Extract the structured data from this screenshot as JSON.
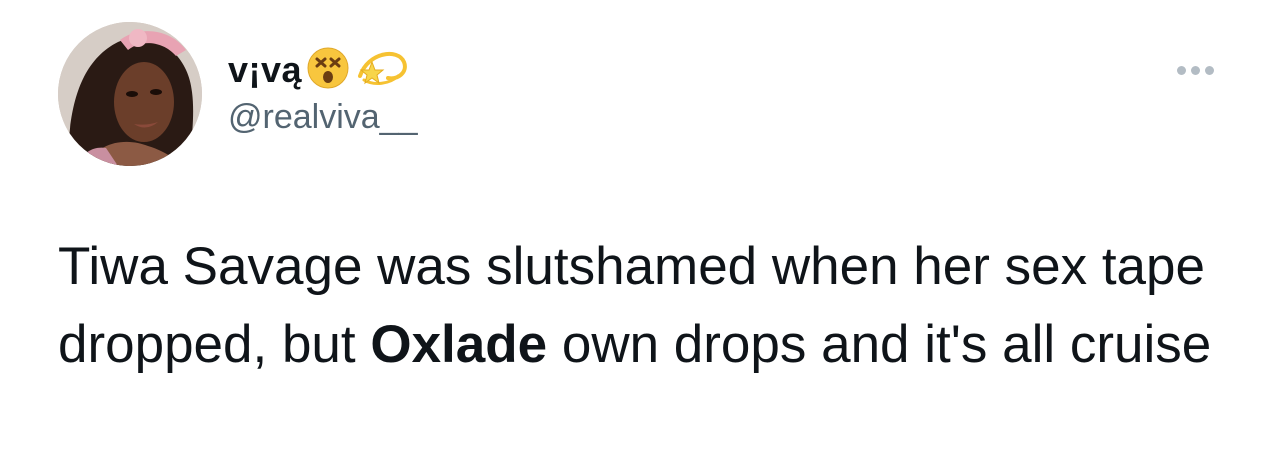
{
  "tweet": {
    "author": {
      "display_name": "v¡vą",
      "handle": "@realviva__",
      "emojis": [
        "dizzy-face-emoji",
        "dizzy-star-emoji"
      ]
    },
    "more_icon": "more-options-icon",
    "text": {
      "part1": "Tiwa Savage was slutshamed when her sex tape dropped, but ",
      "bold": "Oxlade",
      "part2": " own drops and it's all cruise"
    }
  },
  "colors": {
    "text": "#0f1419",
    "secondary": "#536471",
    "dots": "#b3bcc4",
    "background": "#ffffff"
  }
}
